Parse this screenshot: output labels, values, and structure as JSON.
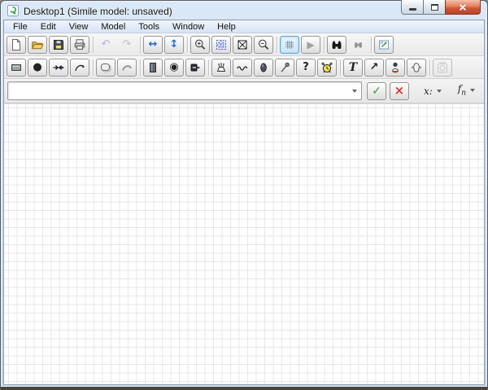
{
  "window": {
    "title": "Desktop1 (Simile model: unsaved)"
  },
  "menu": {
    "items": [
      "File",
      "Edit",
      "View",
      "Model",
      "Tools",
      "Window",
      "Help"
    ]
  },
  "toolbar_main": {
    "undo_glyph": "↶",
    "redo_glyph": "↷",
    "pan_horizontal_glyph": "↔",
    "pan_vertical_glyph": "↕",
    "run_glyph": "▶",
    "grid_toggle_state": "on"
  },
  "toolbar_tools": {
    "variable_glyph": "●",
    "condition_glyph": "◉",
    "query_glyph": "?",
    "text_glyph": "T",
    "pointer_glyph": "↗"
  },
  "equation_bar": {
    "value": "",
    "confirm_glyph": "✓",
    "cancel_glyph": "×",
    "variables_label": "x:",
    "functions_label_main": "f",
    "functions_label_sub": "n"
  },
  "canvas": {
    "background": "#ffffff",
    "grid_color": "#e7e7e7",
    "grid_size_px": 10.5
  },
  "colors": {
    "titlebar_gradient_top": "#dae8f7",
    "titlebar_gradient_bottom": "#c3d6ec",
    "active_button_border": "#5aa6dc",
    "close_button": "#cf5436",
    "confirm_green": "#2e9e3e",
    "cancel_red": "#d43c30"
  }
}
